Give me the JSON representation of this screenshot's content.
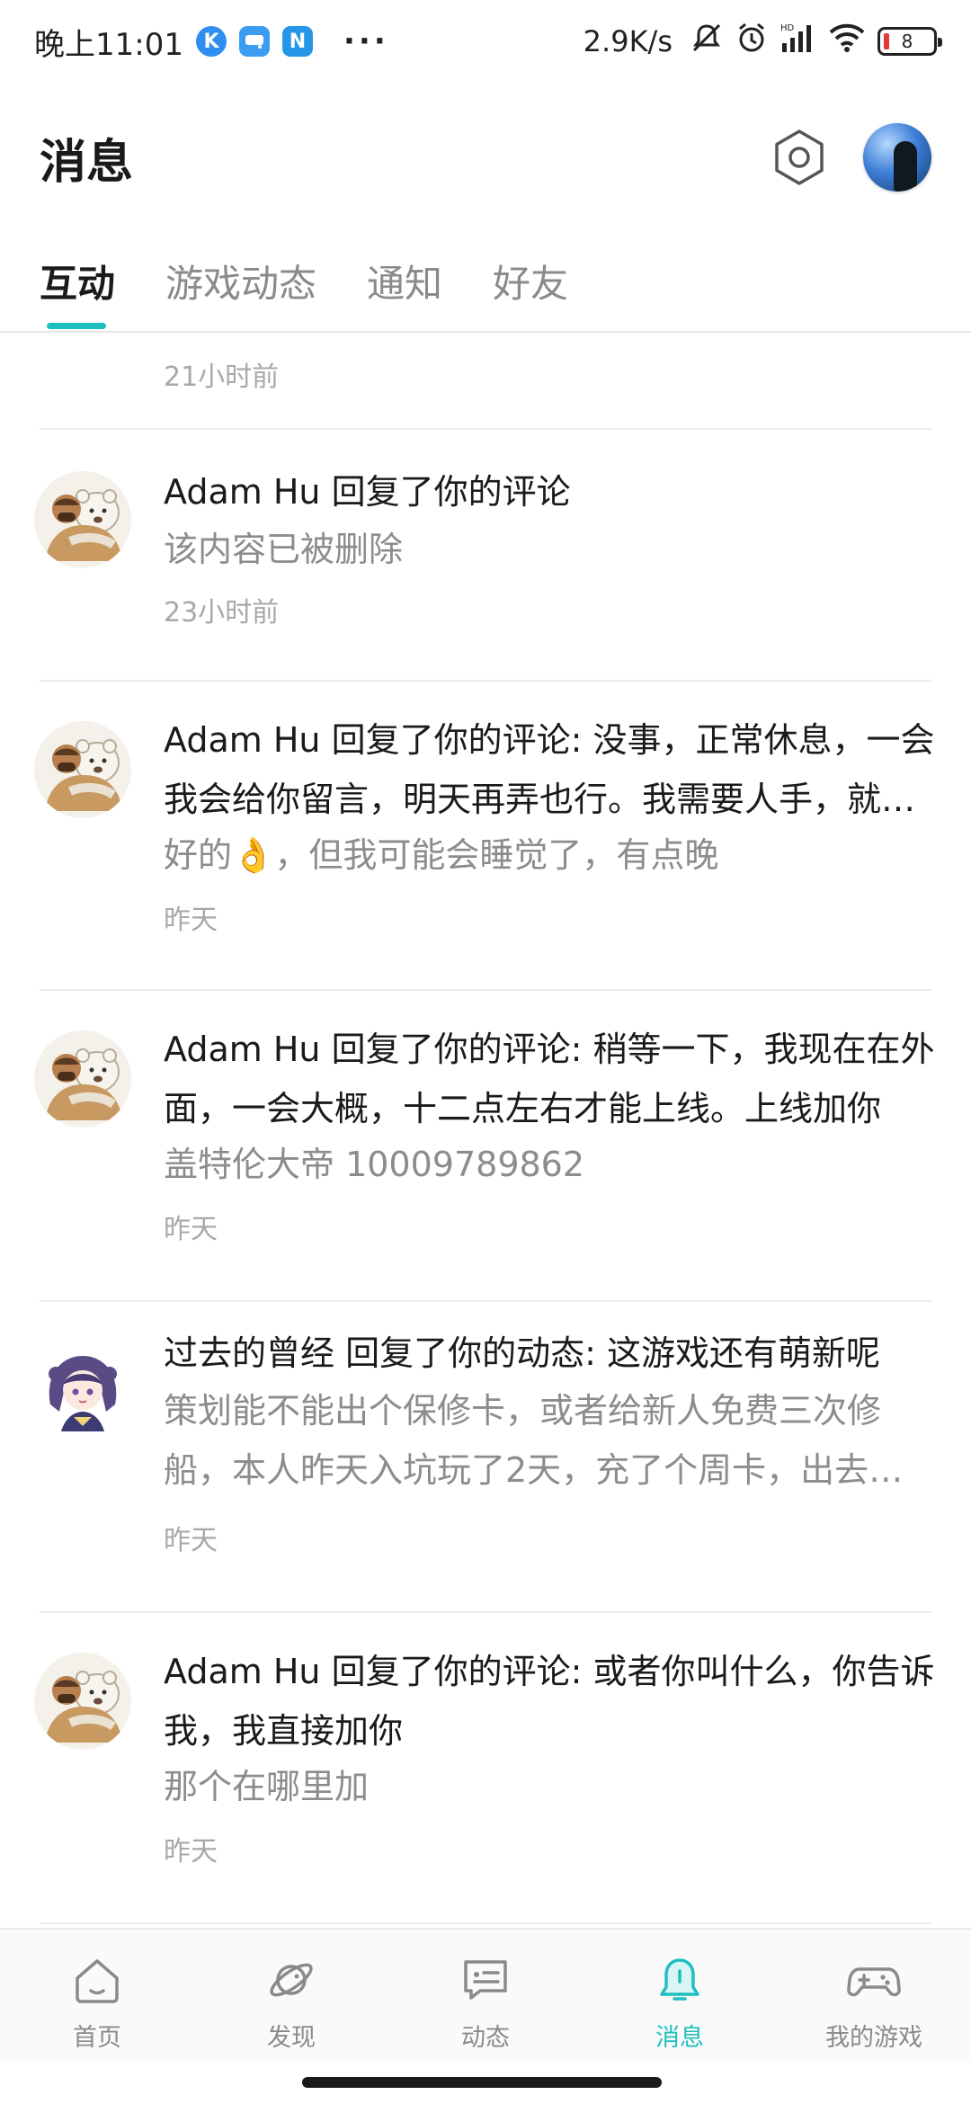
{
  "status_bar": {
    "time": "晚上11:01",
    "net_speed": "2.9K/s",
    "battery_level": "8",
    "app_icons": [
      {
        "name": "k-app-icon",
        "glyph": "K",
        "color": "#2e8ff0"
      },
      {
        "name": "chat-app-icon",
        "glyph": "▬",
        "color": "#3a9df2"
      },
      {
        "name": "n-app-icon",
        "glyph": "N",
        "color": "#2696e8"
      }
    ],
    "more": "···",
    "hd_label": "HD"
  },
  "header": {
    "title": "消息"
  },
  "tabs": [
    {
      "label": "互动",
      "active": true
    },
    {
      "label": "游戏动态",
      "active": false
    },
    {
      "label": "通知",
      "active": false
    },
    {
      "label": "好友",
      "active": false
    }
  ],
  "feed": {
    "partial_time": "21小时前",
    "messages": [
      {
        "avatar": "bear-duo",
        "line1": "Adam Hu 回复了你的评论",
        "quote": "该内容已被删除",
        "time": "23小时前"
      },
      {
        "avatar": "bear-duo",
        "line1": "Adam Hu 回复了你的评论: 没事，正常休息，一会我会给你留言，明天再弄也行。我需要人手，就是你要是有空的话就最好了",
        "quote": "好的👌，但我可能会睡觉了，有点晚",
        "time": "昨天"
      },
      {
        "avatar": "bear-duo",
        "line1": "Adam Hu 回复了你的评论: 稍等一下，我现在在外面，一会大概，十二点左右才能上线。上线加你",
        "quote": "盖特伦大帝 10009789862",
        "time": "昨天"
      },
      {
        "avatar": "anime-girl",
        "line1": "过去的曾经 回复了你的动态: 这游戏还有萌新呢",
        "quote": "策划能不能出个保修卡，或者给新人免费三次修船，本人昨天入坑玩了2天，充了个周卡，出去打了几次就没钱修船了",
        "time": "昨天"
      },
      {
        "avatar": "bear-duo",
        "line1": "Adam Hu 回复了你的评论: 或者你叫什么，你告诉我，我直接加你",
        "quote": "那个在哪里加",
        "time": "昨天"
      }
    ]
  },
  "bottom_nav": [
    {
      "label": "首页",
      "icon": "home-icon",
      "active": false
    },
    {
      "label": "发现",
      "icon": "planet-icon",
      "active": false
    },
    {
      "label": "动态",
      "icon": "feed-icon",
      "active": false
    },
    {
      "label": "消息",
      "icon": "bell-icon",
      "active": true
    },
    {
      "label": "我的游戏",
      "icon": "gamepad-icon",
      "active": false
    }
  ],
  "colors": {
    "accent": "#1fbfbf",
    "text_primary": "#1a1a1a",
    "text_secondary": "#8c8c8c",
    "text_tertiary": "#a8a8a8"
  }
}
